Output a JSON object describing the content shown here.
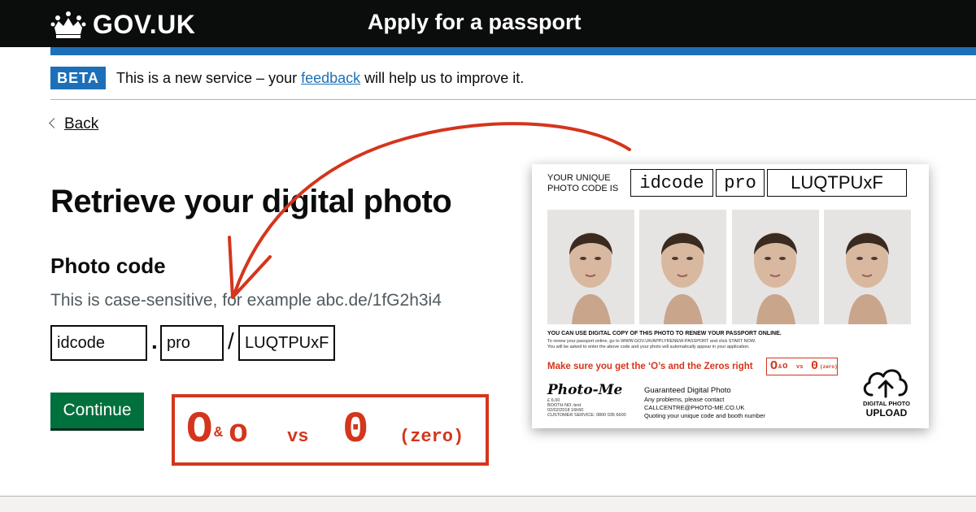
{
  "header": {
    "logo_text": "GOV.UK",
    "service_name": "Apply for a passport"
  },
  "phase_banner": {
    "tag": "BETA",
    "text_before": "This is a new service – your ",
    "link": "feedback",
    "text_after": " will help us to improve it."
  },
  "back_link": "Back",
  "page_title": "Retrieve your digital photo",
  "form": {
    "label": "Photo code",
    "hint": "This is case-sensitive, for example abc.de/1fG2h3i4",
    "field1": "idcode",
    "separator1": ".",
    "field2": "pro",
    "separator2": "/",
    "field3": "LUQTPUxF",
    "continue": "Continue"
  },
  "callout": {
    "o_big": "O",
    "amp": "&",
    "o_small": "o",
    "vs": "vs",
    "zero": "0",
    "zero_label": "(zero)"
  },
  "card": {
    "code_label_line1": "YOUR UNIQUE",
    "code_label_line2": "PHOTO CODE IS",
    "code1": "idcode",
    "code2": "pro",
    "code3": "LUQTPUxF",
    "online_title": "YOU CAN USE DIGITAL COPY OF THIS PHOTO TO RENEW YOUR PASSPORT ONLINE.",
    "online_line1": "To renew your passport online, go to WWW.GOV.UK/APPLYRENEW-PASSPORT and click START NOW.",
    "online_line2": "You will be asked to enter the above code and your photo will automatically appear in your application.",
    "warning": "Make sure you get the ‘O’s and the Zeros right",
    "mini_o": "O",
    "mini_amp": "&",
    "mini_o_small": "o",
    "mini_vs": "vs",
    "mini_zero": "0",
    "mini_zero_label": "(zero)",
    "brand": "Photo-Me",
    "price": "£ 6.00",
    "booth": "BOOTH NO.:text",
    "date": "02/02/2018  16h50",
    "customer_service": "CUSTOMER SERVICE: 0800 035 6600",
    "guaranteed": "Guaranteed Digital Photo",
    "problems": "Any problems, please contact",
    "email": "CALLCENTRE@PHOTO-ME.CO.UK",
    "quoting": "Quoting your unique code and booth number",
    "upload_line1": "DIGITAL PHOTO",
    "upload_line2": "UPLOAD"
  },
  "colors": {
    "header": "#0b0c0c",
    "brand_blue": "#1d70b8",
    "button_green": "#00703c",
    "annotation_red": "#d4351c"
  }
}
